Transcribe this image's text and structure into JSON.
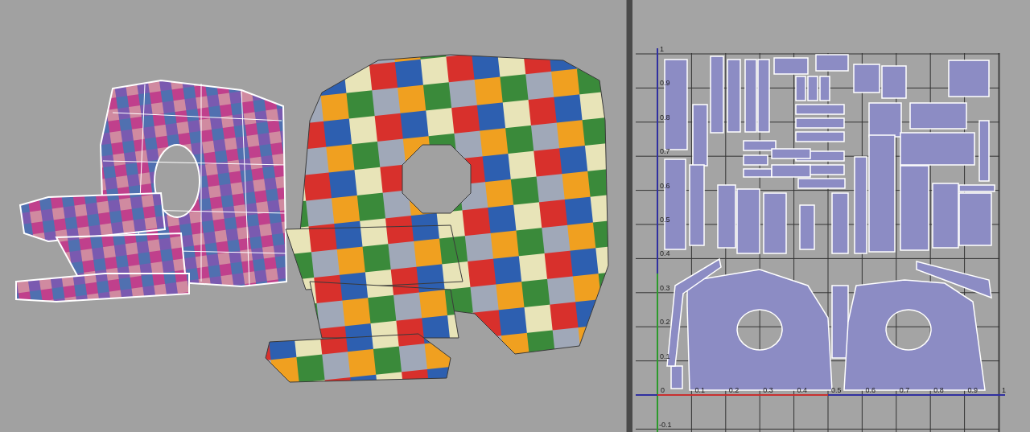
{
  "uv_editor": {
    "u_ticks": [
      "0",
      "0.1",
      "0.2",
      "0.3",
      "0.4",
      "0.5",
      "0.6",
      "0.7",
      "0.8",
      "0.9",
      "1"
    ],
    "v_ticks": [
      "1",
      "0.9",
      "0.8",
      "0.7",
      "0.6",
      "0.5",
      "0.4",
      "0.3",
      "0.2",
      "0.1"
    ],
    "v_below": "-0.1"
  }
}
